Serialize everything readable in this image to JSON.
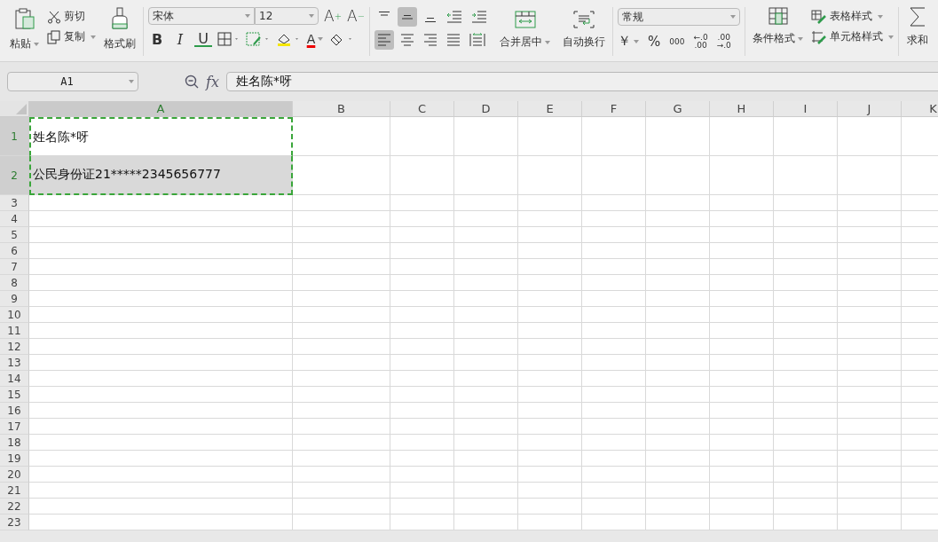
{
  "ribbon": {
    "clipboard": {
      "paste": "粘贴",
      "cut": "剪切",
      "copy": "复制",
      "format_painter": "格式刷"
    },
    "font": {
      "name": "宋体",
      "size": "12",
      "grow": "A",
      "grow_mark": "+",
      "shrink": "A",
      "shrink_mark": "−",
      "bold": "B",
      "italic": "I",
      "underline": "U",
      "font_color": "A"
    },
    "alignment": {
      "vertical": [
        {
          "selected": false
        },
        {
          "selected": true
        },
        {
          "selected": false
        }
      ],
      "horizontal": [
        {
          "selected": true
        },
        {
          "selected": false
        },
        {
          "selected": false
        },
        {
          "selected": false
        }
      ],
      "merge": "合并居中",
      "wrap": "自动换行"
    },
    "number": {
      "format": "常规",
      "currency": "￥",
      "percent": "%",
      "thousands": "000",
      "add_decimal": [
        "←.0",
        ".00"
      ],
      "remove_decimal": [
        ".00",
        "→.0"
      ]
    },
    "styles": {
      "conditional": "条件格式",
      "table_style": "表格样式",
      "cell_style": "单元格样式"
    },
    "sum": "求和"
  },
  "formula_bar": {
    "cell_ref": "A1",
    "fx": "fx",
    "content": "姓名陈*呀"
  },
  "sheet": {
    "columns": [
      {
        "label": "A",
        "selected": true
      },
      {
        "label": "B",
        "selected": false
      },
      {
        "label": "C",
        "selected": false
      },
      {
        "label": "D",
        "selected": false
      },
      {
        "label": "E",
        "selected": false
      },
      {
        "label": "F",
        "selected": false
      },
      {
        "label": "G",
        "selected": false
      },
      {
        "label": "H",
        "selected": false
      },
      {
        "label": "I",
        "selected": false
      },
      {
        "label": "J",
        "selected": false
      },
      {
        "label": "K",
        "selected": false
      }
    ],
    "rows": [
      {
        "label": "1",
        "selected": true,
        "cells": [
          {
            "text": "姓名陈*呀",
            "active": true
          }
        ]
      },
      {
        "label": "2",
        "selected": true,
        "cells": [
          {
            "text": "公民身份证21*****2345656777",
            "active": false
          }
        ]
      },
      {
        "label": "3",
        "selected": false
      },
      {
        "label": "4",
        "selected": false
      },
      {
        "label": "5",
        "selected": false
      },
      {
        "label": "6",
        "selected": false
      },
      {
        "label": "7",
        "selected": false
      },
      {
        "label": "8",
        "selected": false
      },
      {
        "label": "9",
        "selected": false
      },
      {
        "label": "10",
        "selected": false
      },
      {
        "label": "11",
        "selected": false
      },
      {
        "label": "12",
        "selected": false
      },
      {
        "label": "13",
        "selected": false
      },
      {
        "label": "14",
        "selected": false
      },
      {
        "label": "15",
        "selected": false
      },
      {
        "label": "16",
        "selected": false
      },
      {
        "label": "17",
        "selected": false
      },
      {
        "label": "18",
        "selected": false
      },
      {
        "label": "19",
        "selected": false
      },
      {
        "label": "20",
        "selected": false
      },
      {
        "label": "21",
        "selected": false
      },
      {
        "label": "22",
        "selected": false
      },
      {
        "label": "23",
        "selected": false
      }
    ]
  }
}
